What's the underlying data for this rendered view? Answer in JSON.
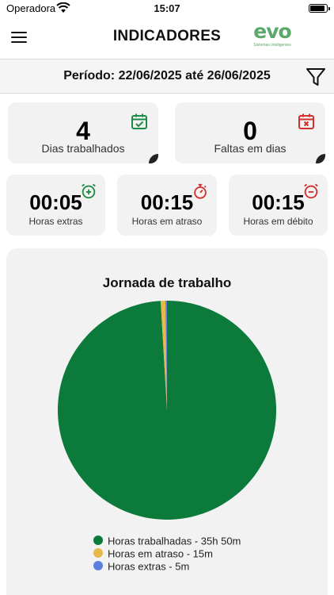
{
  "status_bar": {
    "carrier": "Operadora",
    "time": "15:07",
    "battery_level": 0.95
  },
  "header": {
    "title": "INDICADORES",
    "logo_text": "evo",
    "logo_tagline": "Sistemas Inteligentes"
  },
  "period": {
    "text": "Período: 22/06/2025 até 26/06/2025"
  },
  "cards": {
    "worked_days": {
      "value": "4",
      "label": "Dias trabalhados",
      "color": "#1e8a44",
      "icon": "calendar-check-icon"
    },
    "absences": {
      "value": "0",
      "label": "Faltas em dias",
      "color": "#d32f2f",
      "icon": "calendar-x-icon"
    },
    "extra_hours": {
      "value": "00:05",
      "label": "Horas extras",
      "color": "#1e8a44",
      "icon": "alarm-plus-icon"
    },
    "late_hours": {
      "value": "00:15",
      "label": "Horas em atraso",
      "color": "#d32f2f",
      "icon": "stopwatch-icon"
    },
    "debit_hours": {
      "value": "00:15",
      "label": "Horas em débito",
      "color": "#d32f2f",
      "icon": "alarm-minus-icon"
    }
  },
  "chart": {
    "title": "Jornada de trabalho"
  },
  "chart_data": {
    "type": "pie",
    "title": "Jornada de trabalho",
    "unit": "minutes",
    "slices": [
      {
        "label": "Horas trabalhadas - 35h 50m",
        "value": 2150,
        "color": "#0b7a3a"
      },
      {
        "label": "Horas em atraso - 15m",
        "value": 15,
        "color": "#e8b84a"
      },
      {
        "label": "Horas extras - 5m",
        "value": 5,
        "color": "#5b80e0"
      }
    ],
    "legend_position": "bottom"
  }
}
